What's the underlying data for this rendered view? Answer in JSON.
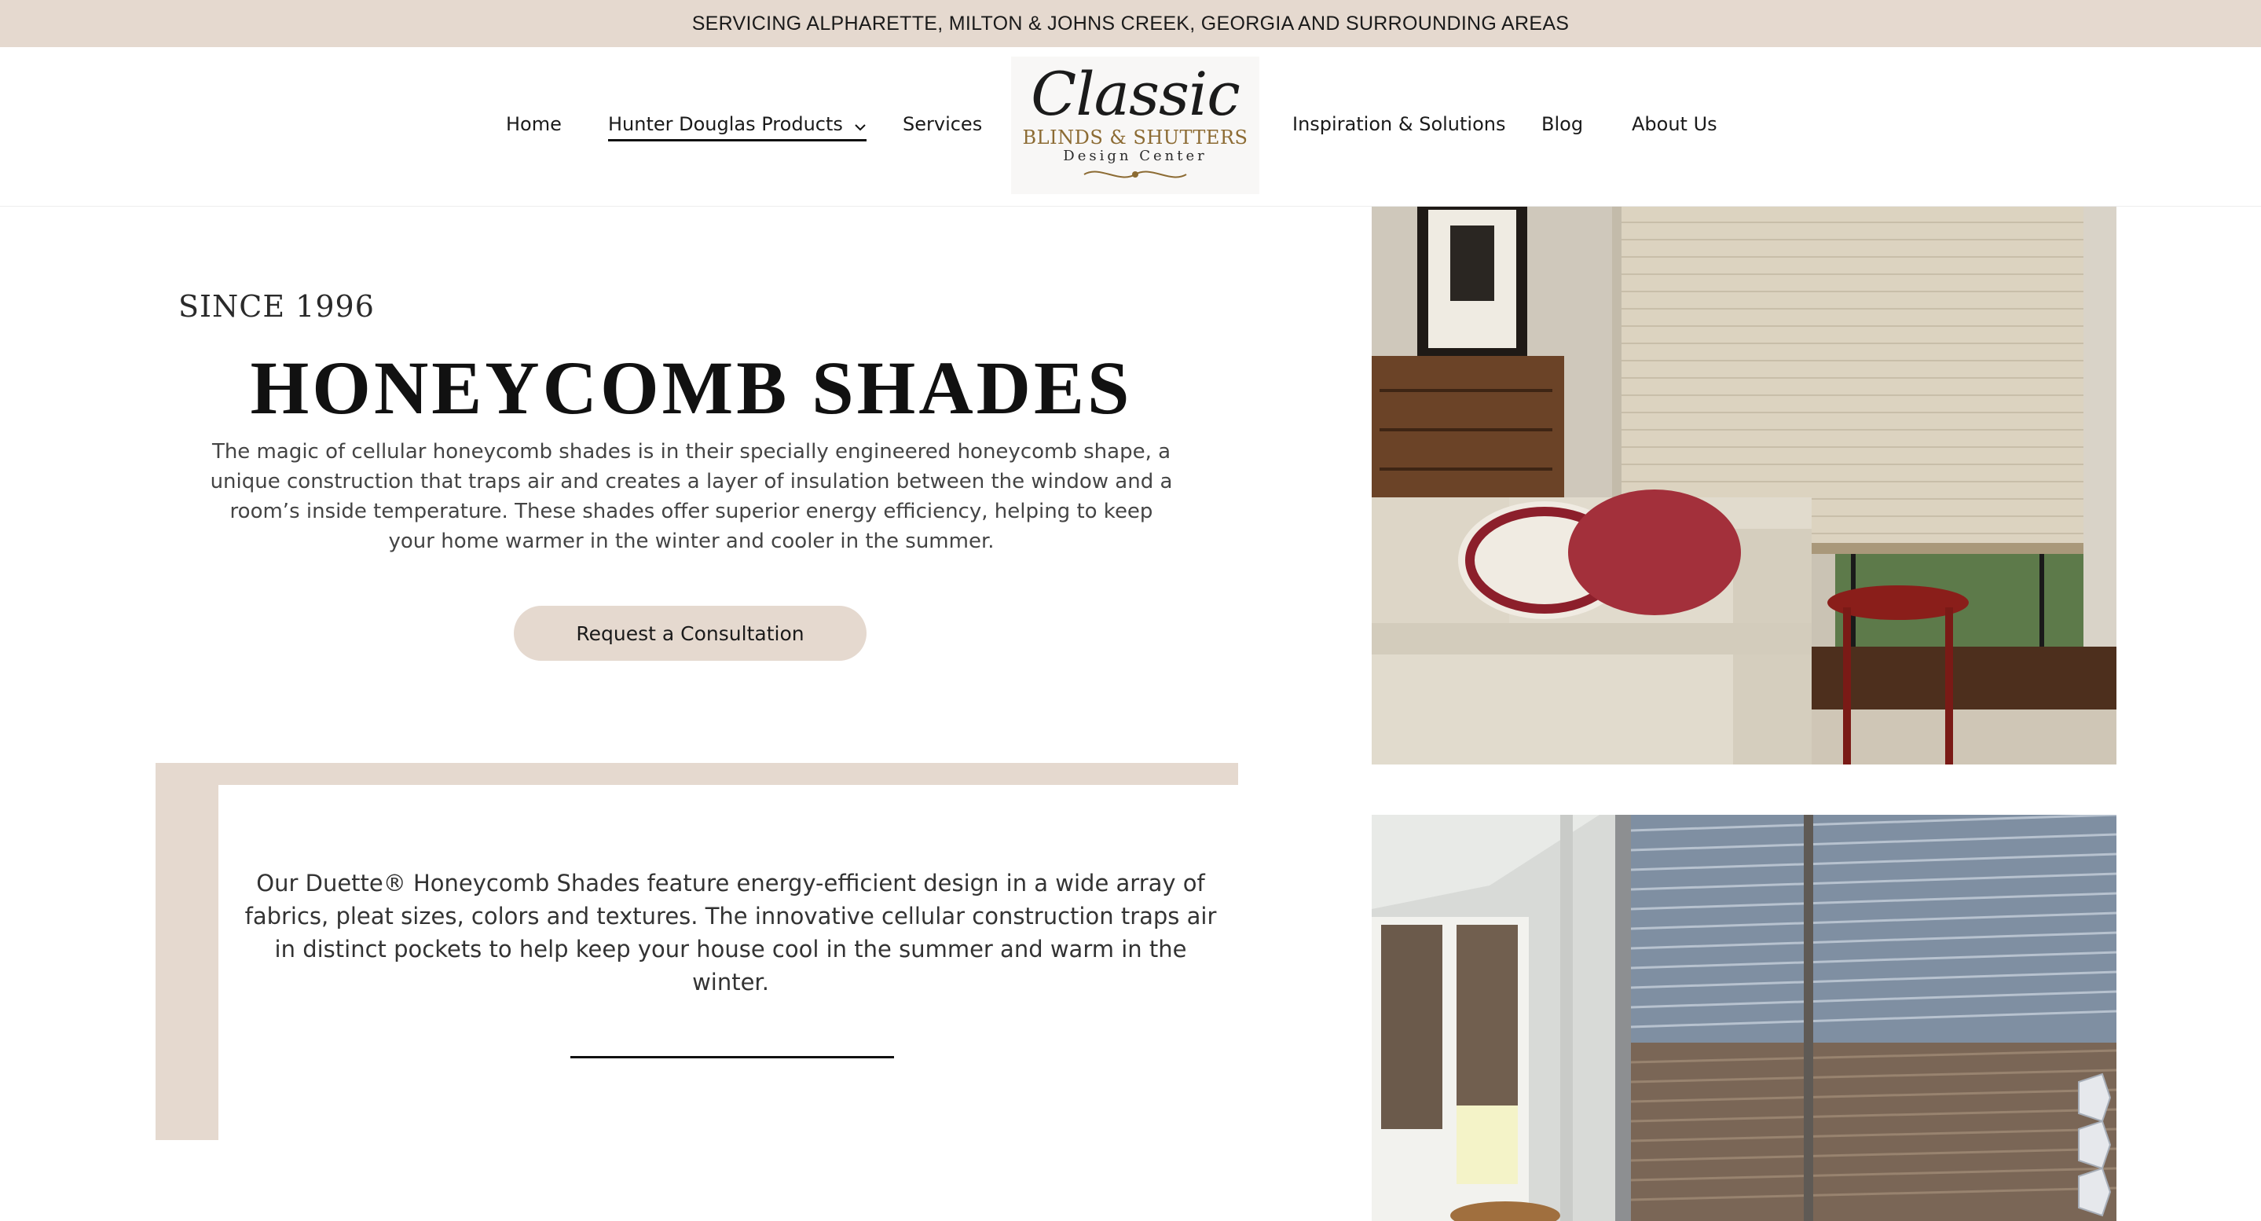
{
  "announcement": {
    "text": "SERVICING ALPHARETTE, MILTON & JOHNS CREEK, GEORGIA AND SURROUNDING AREAS"
  },
  "nav": {
    "home": "Home",
    "products": "Hunter Douglas Products",
    "services": "Services",
    "inspiration": "Inspiration & Solutions",
    "blog": "Blog",
    "about": "About Us"
  },
  "logo": {
    "script": "Classic",
    "line1": "BLINDS & SHUTTERS",
    "line2": "Design Center"
  },
  "hero": {
    "eyebrow": "SINCE 1996",
    "title": "HONEYCOMB SHADES",
    "intro": "The magic of cellular honeycomb shades is in their specially engineered honeycomb shape, a unique construction that traps air and creates a layer of insulation between the window and a room’s inside temperature. These shades offer superior energy efficiency, helping to keep your home warmer in the winter and cooler in the summer.",
    "cta": "Request a Consultation"
  },
  "feature": {
    "text": "Our Duette® Honeycomb Shades feature energy-efficient design in a wide array of fabrics, pleat sizes, colors and textures. The innovative cellular construction traps air in distinct pockets to help keep your house cool in the summer and warm in the winter."
  },
  "colors": {
    "accent": "#e5d9cf",
    "text": "#1a1a1a",
    "logo_gold": "#8c6b33"
  },
  "icons": {
    "dropdown": "chevron-down-icon"
  }
}
